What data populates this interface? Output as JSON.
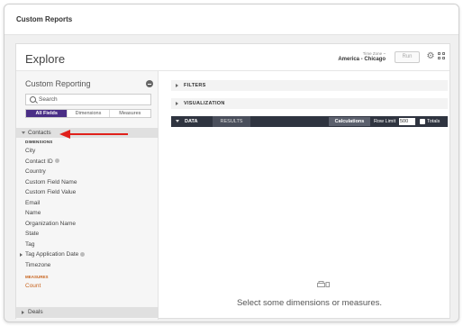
{
  "topbar": {
    "title": "Custom Reports"
  },
  "header": {
    "title": "Explore",
    "timezone_label": "Time Zone ~",
    "timezone_value": "America - Chicago",
    "run_label": "Run"
  },
  "sidebar": {
    "title": "Custom Reporting",
    "search_placeholder": "Search",
    "filter_tabs": [
      "All Fields",
      "Dimensions",
      "Measures"
    ],
    "active_tab": "All Fields",
    "groups": {
      "contacts": "Contacts",
      "deals": "Deals"
    },
    "dimensions_label": "DIMENSIONS",
    "dimensions": [
      "City",
      "Contact ID",
      "Country",
      "Custom Field Name",
      "Custom Field Value",
      "Email",
      "Name",
      "Organization Name",
      "State",
      "Tag",
      "Tag Application Date",
      "Timezone"
    ],
    "measures_label": "MEASURES",
    "measures": [
      "Count"
    ]
  },
  "main": {
    "filters_label": "FILTERS",
    "visualization_label": "VISUALIZATION",
    "data_label": "DATA",
    "results_label": "RESULTS",
    "calculations_label": "Calculations",
    "row_limit_label": "Row Limit",
    "row_limit_value": "500",
    "totals_label": "Totals",
    "empty_message": "Select some dimensions or measures."
  },
  "colors": {
    "active_tab": "#4a2e86",
    "data_bar": "#2f3440",
    "measure": "#c8641e",
    "arrow": "#e0201b"
  }
}
